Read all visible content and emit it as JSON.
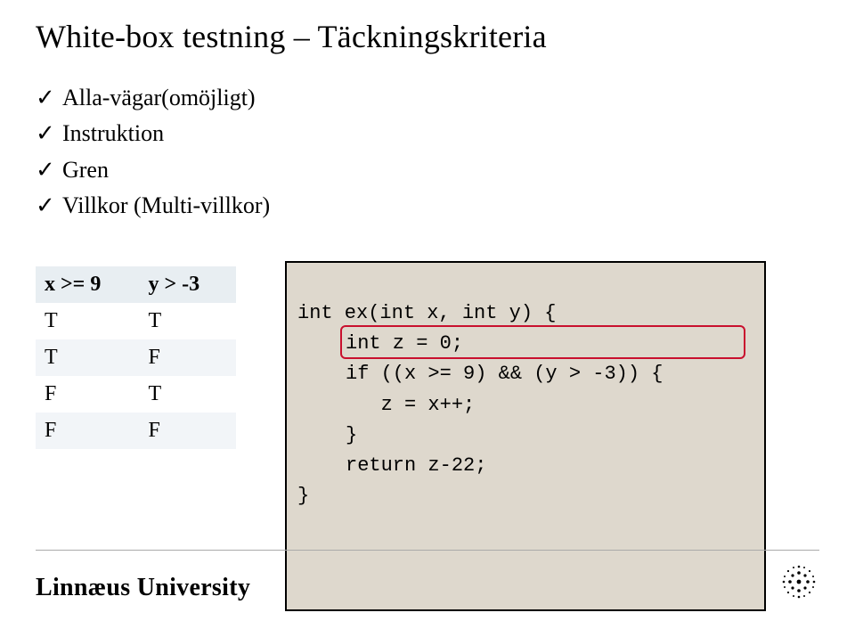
{
  "title": "White-box testning – Täckningskriteria",
  "bullets": {
    "b0": "Alla-vägar(omöjligt)",
    "b1": "Instruktion",
    "b2": "Gren",
    "b3": "Villkor (Multi-villkor)"
  },
  "checkmark": "✓",
  "truth_table": {
    "header_x": "x >= 9",
    "header_y": "y > -3",
    "rows": {
      "r0c0": "T",
      "r0c1": "T",
      "r1c0": "T",
      "r1c1": "F",
      "r2c0": "F",
      "r2c1": "T",
      "r3c0": "F",
      "r3c1": "F"
    }
  },
  "code": {
    "l0": "int ex(int x, int y) {",
    "l1": "int z = 0;",
    "l2": "if ((x >= 9) && (y > -3)) {",
    "l3": "   z = x++;",
    "l4": "}",
    "l5": "return z-22;",
    "l6": "}"
  },
  "chart_data": {
    "type": "table",
    "title": "Multi-condition truth table for (x >= 9) && (y > -3)",
    "columns": [
      "x >= 9",
      "y > -3"
    ],
    "rows": [
      [
        "T",
        "T"
      ],
      [
        "T",
        "F"
      ],
      [
        "F",
        "T"
      ],
      [
        "F",
        "F"
      ]
    ]
  },
  "footer": {
    "wordmark": "Linnæus University"
  },
  "colors": {
    "code_bg": "#ded8cd",
    "highlight_border": "#c9102e",
    "table_header_bg": "#e8eef2",
    "table_alt_bg": "#f2f5f8"
  }
}
